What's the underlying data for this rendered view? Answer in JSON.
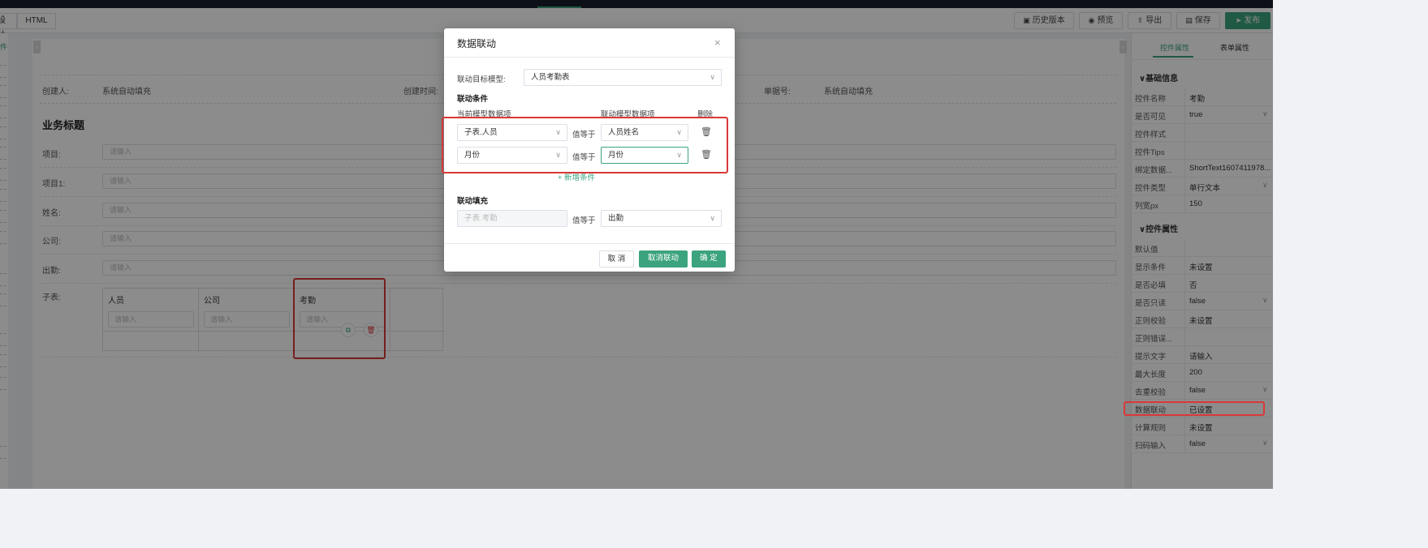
{
  "toolbar": {
    "tab_design": "设计",
    "tab_html": "HTML",
    "history_label": "历史版本",
    "preview_label": "预览",
    "export_label": "导出",
    "save_label": "保存",
    "publish_label": "发布",
    "colors": {
      "accent": "#3ba37d",
      "topbar": "#19202b"
    }
  },
  "left_strip": {
    "top_label": "件",
    "items": [
      "",
      "",
      "",
      "",
      "",
      "",
      "",
      "",
      "",
      "选",
      "选",
      "",
      "胭",
      "",
      "",
      "",
      "",
      "间",
      "",
      "",
      "",
      "选"
    ]
  },
  "form": {
    "creator_label": "创建人:",
    "creator_value": "系统自动填充",
    "created_time_label": "创建时间:",
    "doc_no_label": "单据号:",
    "doc_no_value": "系统自动填充",
    "biz_title": "业务标题",
    "fields": [
      {
        "label": "项目:",
        "placeholder": "请输入"
      },
      {
        "label": "项目1:",
        "placeholder": "请输入"
      },
      {
        "label": "姓名:",
        "placeholder": "请输入"
      },
      {
        "label": "公司:",
        "placeholder": "请输入"
      },
      {
        "label": "出勤:",
        "placeholder": "请输入"
      }
    ],
    "subtable": {
      "label": "子表:",
      "columns": [
        "人员",
        "公司",
        "考勤"
      ],
      "placeholder": "请输入"
    }
  },
  "right_panel": {
    "tabs": [
      "控件属性",
      "表单属性"
    ],
    "section_basic": "基础信息",
    "section_props": "控件属性",
    "basic_rows": [
      {
        "label": "控件名称",
        "value": "考勤",
        "dropdown": false
      },
      {
        "label": "是否可见",
        "value": "true",
        "dropdown": true
      },
      {
        "label": "控件样式",
        "value": "",
        "dropdown": false
      },
      {
        "label": "控件Tips",
        "value": "",
        "dropdown": false
      },
      {
        "label": "绑定数据...",
        "value": "ShortText1607411978...",
        "dropdown": false
      },
      {
        "label": "控件类型",
        "value": "单行文本",
        "dropdown": true
      },
      {
        "label": "列宽px",
        "value": "150",
        "dropdown": false
      }
    ],
    "prop_rows": [
      {
        "label": "默认值",
        "value": "",
        "dropdown": false
      },
      {
        "label": "显示条件",
        "value": "未设置",
        "dropdown": false
      },
      {
        "label": "是否必填",
        "value": "否",
        "dropdown": false
      },
      {
        "label": "是否只读",
        "value": "false",
        "dropdown": true
      },
      {
        "label": "正则校验",
        "value": "未设置",
        "dropdown": false
      },
      {
        "label": "正则错误...",
        "value": "",
        "dropdown": false
      },
      {
        "label": "提示文字",
        "value": "请输入",
        "dropdown": false
      },
      {
        "label": "最大长度",
        "value": "200",
        "dropdown": false
      },
      {
        "label": "去重校验",
        "value": "false",
        "dropdown": true
      },
      {
        "label": "数据联动",
        "value": "已设置",
        "dropdown": false
      },
      {
        "label": "计算规则",
        "value": "未设置",
        "dropdown": false
      },
      {
        "label": "扫码输入",
        "value": "false",
        "dropdown": true
      }
    ]
  },
  "modal": {
    "title": "数据联动",
    "target_model_label": "联动目标模型:",
    "target_model_value": "人员考勤表",
    "conditions_label": "联动条件",
    "col_current": "当前模型数据项",
    "col_linked": "联动模型数据项",
    "col_delete": "删除",
    "conditions": [
      {
        "current": "子表.人员",
        "op": "值等于",
        "linked": "人员姓名"
      },
      {
        "current": "月份",
        "op": "值等于",
        "linked": "月份"
      }
    ],
    "add_condition": "+ 新增条件",
    "fill_label": "联动填充",
    "fill": {
      "current": "子表.考勤",
      "op": "值等于",
      "linked": "出勤"
    },
    "btn_cancel": "取 消",
    "btn_unlink": "取消联动",
    "btn_confirm": "确 定"
  }
}
